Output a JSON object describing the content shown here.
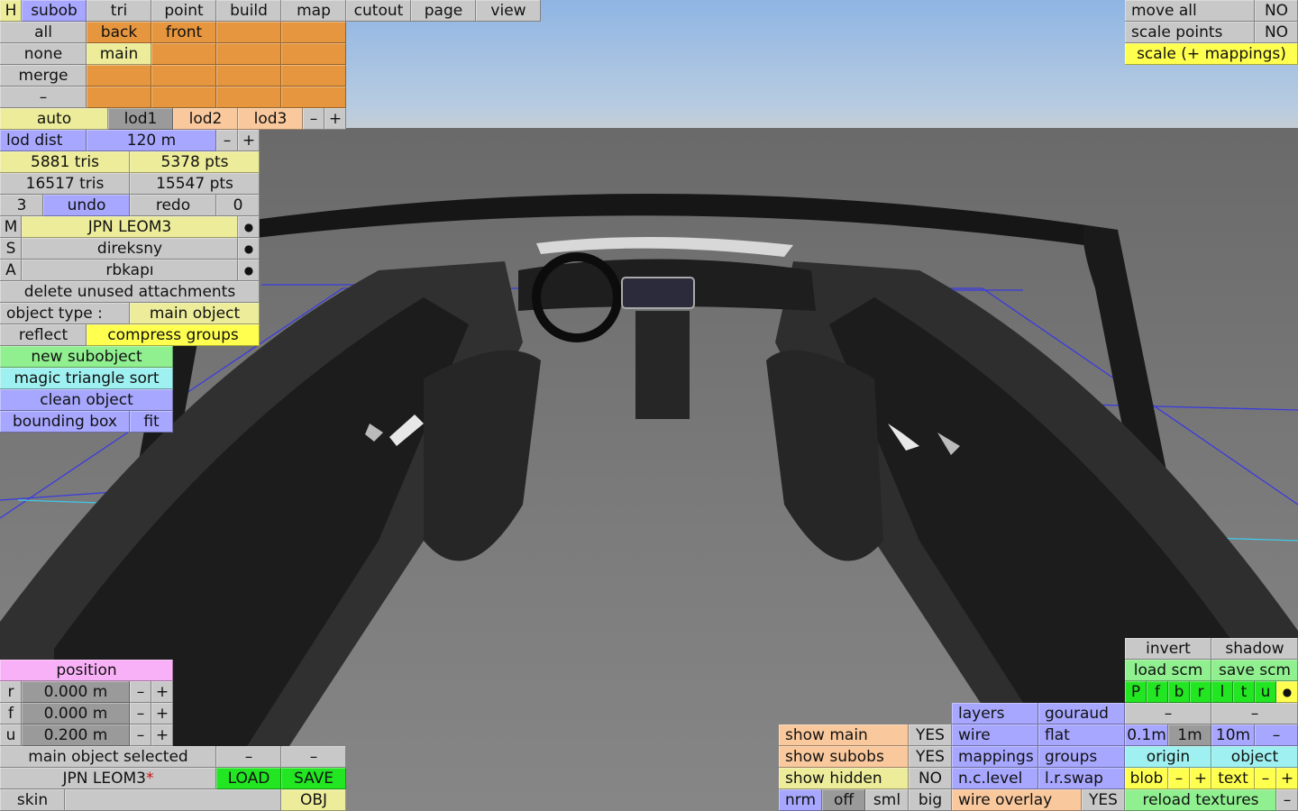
{
  "tabs": {
    "h": "H",
    "subob": "subob",
    "tri": "tri",
    "point": "point",
    "build": "build",
    "map": "map",
    "cutout": "cutout",
    "page": "page",
    "view": "view"
  },
  "select": {
    "all": "all",
    "none": "none",
    "merge": "merge",
    "dash": "–",
    "back": "back",
    "front": "front",
    "main": "main"
  },
  "lod": {
    "auto": "auto",
    "lod1": "lod1",
    "lod2": "lod2",
    "lod3": "lod3",
    "minus": "–",
    "plus": "+",
    "dist_label": "lod dist",
    "dist_value": "120 m"
  },
  "stats": {
    "tris1": "5881 tris",
    "pts1": "5378 pts",
    "tris2": "16517 tris",
    "pts2": "15547 pts"
  },
  "undo": {
    "count": "3",
    "undo": "undo",
    "redo": "redo",
    "redo_count": "0"
  },
  "models": [
    {
      "key": "M",
      "name": "JPN LEOM3",
      "dot": "●"
    },
    {
      "key": "S",
      "name": "direksny",
      "dot": "●"
    },
    {
      "key": "A",
      "name": "rbkapı",
      "dot": "●"
    }
  ],
  "actions": {
    "delete_unused": "delete unused attachments",
    "object_type_label": "object type :",
    "object_type_value": "main object",
    "reflect": "reflect",
    "compress": "compress groups",
    "new_subobject": "new subobject",
    "magic_sort": "magic triangle sort",
    "clean_object": "clean object",
    "bounding_box": "bounding box",
    "fit": "fit"
  },
  "topright": {
    "move_all": "move all",
    "move_all_val": "NO",
    "scale_points": "scale points",
    "scale_points_val": "NO",
    "scale_map": "scale (+ mappings)"
  },
  "position": {
    "title": "position",
    "rows": [
      {
        "axis": "r",
        "value": "0.000 m"
      },
      {
        "axis": "f",
        "value": "0.000 m"
      },
      {
        "axis": "u",
        "value": "0.200 m"
      }
    ],
    "minus": "–",
    "plus": "+"
  },
  "file": {
    "selected": "main object selected",
    "dash": "–",
    "name": "JPN LEOM3",
    "modified": "*",
    "load": "LOAD",
    "save": "SAVE",
    "skin": "skin",
    "skin_value": "",
    "obj": "OBJ"
  },
  "show": {
    "main": "show main",
    "main_val": "YES",
    "subobs": "show subobs",
    "subobs_val": "YES",
    "hidden": "show hidden",
    "hidden_val": "NO",
    "nrm": "nrm",
    "off": "off",
    "sml": "sml",
    "big": "big"
  },
  "render": {
    "layers": "layers",
    "gouraud": "gouraud",
    "wire": "wire",
    "flat": "flat",
    "mappings": "mappings",
    "groups": "groups",
    "nclevel": "n.c.level",
    "lrswap": "l.r.swap",
    "wire_overlay": "wire overlay",
    "wire_overlay_val": "YES"
  },
  "br": {
    "invert": "invert",
    "shadow": "shadow",
    "load_scm": "load scm",
    "save_scm": "save scm",
    "flags": [
      "P",
      "f",
      "b",
      "r",
      "l",
      "t",
      "u",
      "●"
    ],
    "dash": "–",
    "grid": [
      "0.1m",
      "1m",
      "10m",
      "–"
    ],
    "origin": "origin",
    "object": "object",
    "blob": "blob",
    "text": "text",
    "minus": "–",
    "plus": "+",
    "reload": "reload textures"
  }
}
